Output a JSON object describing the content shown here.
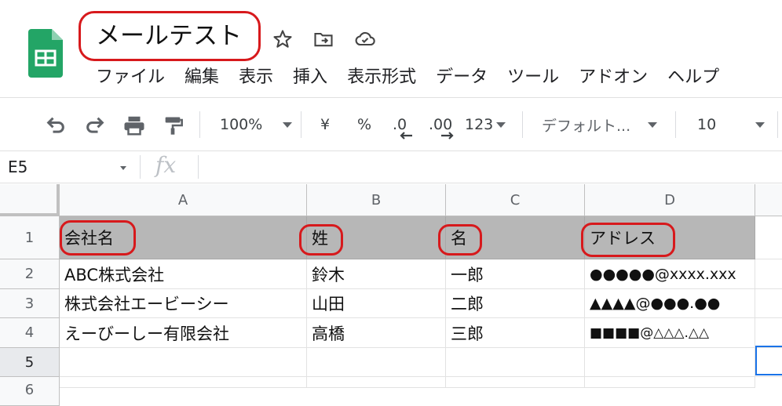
{
  "document": {
    "title": "メールテスト"
  },
  "menu": [
    "ファイル",
    "編集",
    "表示",
    "挿入",
    "表示形式",
    "データ",
    "ツール",
    "アドオン",
    "ヘルプ"
  ],
  "toolbar": {
    "zoom": "100%",
    "currency": "¥",
    "percent": "%",
    "decrease_decimal": ".0",
    "increase_decimal": ".00",
    "more_formats": "123",
    "font": "デフォルト...",
    "font_size": "10"
  },
  "formula_bar": {
    "cell_ref": "E5",
    "fx": "fx"
  },
  "grid": {
    "columns": [
      "A",
      "B",
      "C",
      "D"
    ],
    "rows": [
      "1",
      "2",
      "3",
      "4",
      "5",
      "6"
    ],
    "header_row": [
      "会社名",
      "姓",
      "名",
      "アドレス"
    ],
    "data": [
      [
        "ABC株式会社",
        "鈴木",
        "一郎",
        "●●●●●@xxxx.xxx"
      ],
      [
        "株式会社エービーシー",
        "山田",
        "二郎",
        "▲▲▲▲@●●●.●●"
      ],
      [
        "えーびーしー有限会社",
        "高橋",
        "三郎",
        "■■■■@△△△.△△"
      ]
    ]
  },
  "colors": {
    "logo_green": "#23a566",
    "highlight_red": "#d7191c",
    "header_fill": "#b7b7b7",
    "selection_blue": "#1a73e8"
  },
  "icons": [
    "sheets-logo-icon",
    "star-icon",
    "move-to-folder-icon",
    "cloud-saved-icon",
    "undo-icon",
    "redo-icon",
    "print-icon",
    "paint-format-icon"
  ]
}
